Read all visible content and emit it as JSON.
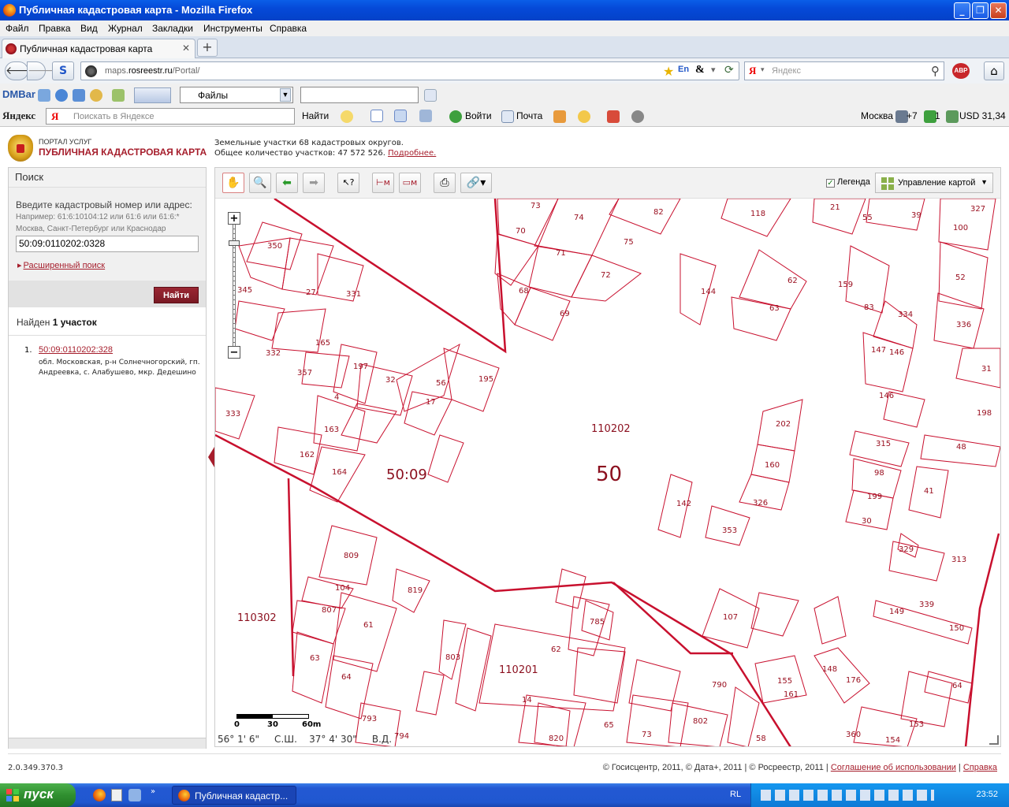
{
  "window": {
    "title": "Публичная кадастровая карта - Mozilla Firefox"
  },
  "menu": [
    "Файл",
    "Правка",
    "Вид",
    "Журнал",
    "Закладки",
    "Инструменты",
    "Справка"
  ],
  "tab": {
    "title": "Публичная кадастровая карта"
  },
  "nav": {
    "url_host_prefix": "maps.",
    "url_host": "rosreestr.ru",
    "url_path": "/Portal/",
    "search_placeholder": "Яндекс",
    "search_logo": "Я"
  },
  "toolbar1": {
    "brand": "DMBar",
    "files_select": "Файлы"
  },
  "toolbar2": {
    "brand": "Яндекс",
    "search_placeholder": "Поискать в Яндексе",
    "find": "Найти",
    "login": "Войти",
    "mail": "Почта",
    "city": "Москва",
    "temp": "+7",
    "count": "1",
    "currency": "USD 31,34"
  },
  "header": {
    "portal_small": "ПОРТАЛ УСЛУГ",
    "portal_big": "ПУБЛИЧНАЯ КАДАСТРОВАЯ КАРТА",
    "info1": "Земельные участки 68 кадастровых округов.",
    "info2": "Общее количество участков: 47 572 526.",
    "info2_link": "Подробнее."
  },
  "search": {
    "title": "Поиск",
    "label": "Введите кадастровый номер или адрес:",
    "example": "Например: 61:6:10104:12 или 61:6 или 61:6:*",
    "example2": "Москва, Санкт-Петербург или Краснодар",
    "value": "50:09:0110202:0328",
    "advanced": "Расширенный поиск",
    "button": "Найти"
  },
  "results": {
    "found_prefix": "Найден ",
    "found_count": "1 участок",
    "items": [
      {
        "num": "1.",
        "link": "50:09:0110202:328",
        "address": "обл. Московская, р-н Солнечногорский, гп. Андреевка, с. Алабушево, мкр. Дедешино"
      }
    ]
  },
  "maptools": {
    "legend": "Легенда",
    "management": "Управление картой"
  },
  "map": {
    "labels": {
      "district_large": "50",
      "district_code": "50:09",
      "quarter_a": "110202",
      "quarter_b": "110302",
      "quarter_c": "110201"
    },
    "scale": {
      "zero": "0",
      "mid": "30",
      "end": "60m"
    },
    "coords": "56° 1' 6\"     С.Ш.    37° 4' 30\"     В.Д."
  },
  "footer": {
    "version": "2.0.349.370.3",
    "copyright": "© Госисцентр, 2011, © Дата+, 2011  | © Росреестр, 2011  |",
    "terms": "Соглашение об использовании",
    "sep": " | ",
    "help": "Справка"
  },
  "taskbar": {
    "start": "пуск",
    "task": "Публичная кадастр...",
    "lang": "RL",
    "clock": "23:52"
  },
  "parcel_numbers": [
    "73",
    "74",
    "82",
    "118",
    "21",
    "55",
    "39",
    "327",
    "100",
    "70",
    "71",
    "75",
    "62",
    "159",
    "52",
    "72",
    "144",
    "63",
    "83",
    "334",
    "336",
    "68",
    "69",
    "147",
    "146",
    "31",
    "146",
    "198",
    "315",
    "48",
    "98",
    "41",
    "199",
    "30",
    "329",
    "313",
    "339",
    "149",
    "150",
    "202",
    "160",
    "326",
    "142",
    "353",
    "107",
    "155",
    "161",
    "148",
    "176",
    "64",
    "360",
    "154",
    "153",
    "350",
    "345",
    "27",
    "331",
    "165",
    "332",
    "357",
    "197",
    "32",
    "56",
    "195",
    "17",
    "4",
    "163",
    "162",
    "164",
    "333",
    "809",
    "104",
    "819",
    "807",
    "61",
    "63",
    "64",
    "793",
    "794",
    "785",
    "803",
    "62",
    "14",
    "790",
    "802",
    "65",
    "820",
    "73",
    "58"
  ]
}
